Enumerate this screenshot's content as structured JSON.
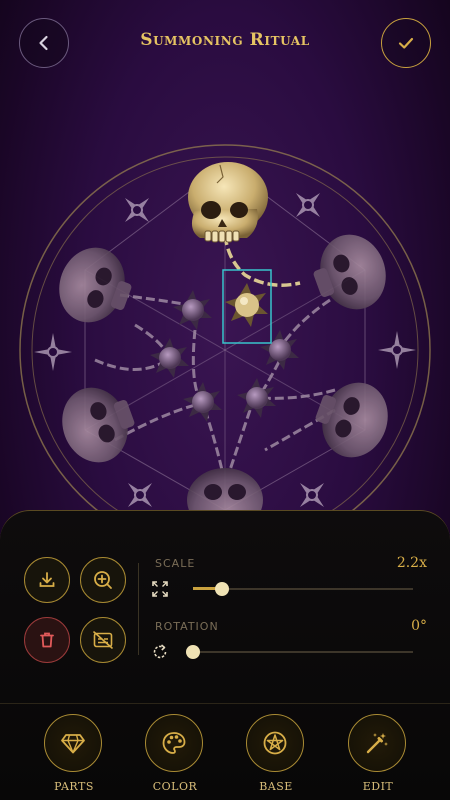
{
  "header": {
    "title": "Summoning Ritual",
    "back_icon": "chevron-left-icon",
    "confirm_icon": "check-icon"
  },
  "toolbar": {
    "tools": [
      {
        "name": "download",
        "icon": "download-icon"
      },
      {
        "name": "zoom-in",
        "icon": "zoom-in-icon"
      },
      {
        "name": "delete",
        "icon": "trash-icon"
      },
      {
        "name": "hide-text",
        "icon": "no-caption-icon"
      }
    ]
  },
  "sliders": {
    "scale": {
      "label": "SCALE",
      "value_text": "2.2x",
      "fraction": 0.13,
      "icon": "fullscreen-icon"
    },
    "rotation": {
      "label": "ROTATION",
      "value_text": "0°",
      "fraction": 0.0,
      "icon": "rotate-icon"
    }
  },
  "nav": {
    "items": [
      {
        "label": "PARTS",
        "icon": "gem-icon"
      },
      {
        "label": "COLOR",
        "icon": "palette-icon"
      },
      {
        "label": "BASE",
        "icon": "pentagram-icon"
      },
      {
        "label": "EDIT",
        "icon": "magic-wand-icon"
      }
    ]
  },
  "colors": {
    "accent_gold": "#d8ae48",
    "background_purple": "#2a0c40",
    "selection_cyan": "#38c4cc",
    "danger_red": "#9a3a3a"
  }
}
